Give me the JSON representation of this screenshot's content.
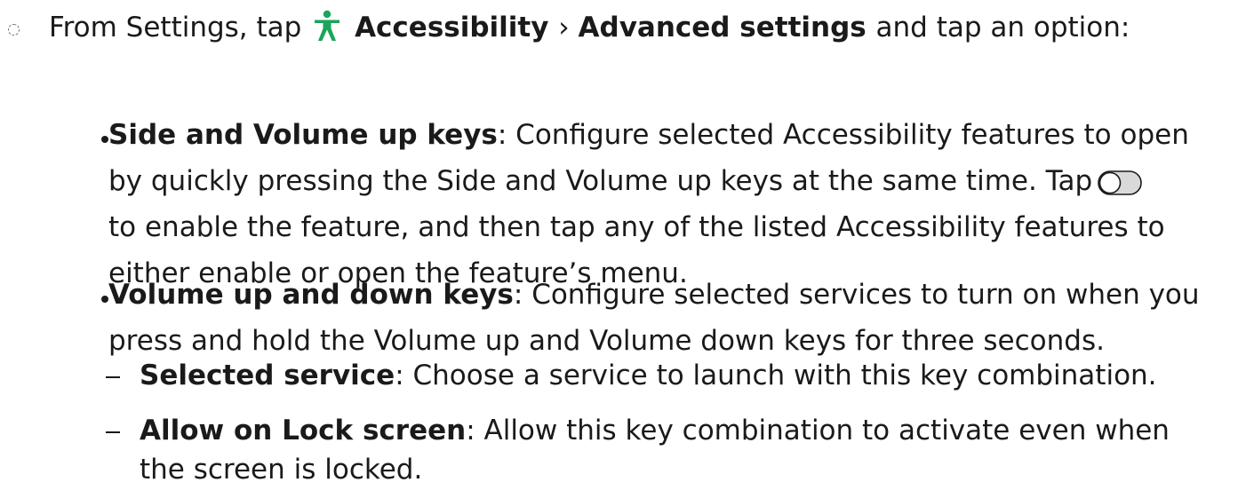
{
  "step": {
    "prefix": "From Settings, tap",
    "accessibility_label": "Accessibility",
    "separator": "›",
    "advanced_label": "Advanced settings",
    "suffix": "and tap an option:"
  },
  "bullets": [
    {
      "term": "Side and Volume up keys",
      "lines": [
        ": Configure selected Accessibility features to open",
        "by quickly pressing the Side and Volume up keys at the same time. Tap",
        "to enable the feature, and then tap any of the listed Accessibility features to",
        "either enable or open the feature’s menu."
      ]
    },
    {
      "term": "Volume up and down keys",
      "lines": [
        ": Configure selected services to turn on when you",
        "press and hold the Volume up and Volume down keys for three seconds."
      ]
    }
  ],
  "subitems": [
    {
      "term": "Selected service",
      "lines": [
        ": Choose a service to launch with this key combination."
      ]
    },
    {
      "term": "Allow on Lock screen",
      "lines": [
        ": Allow this key combination to activate even when",
        "the screen is locked."
      ]
    }
  ],
  "icons": {
    "step_marker": "dotted-circle-icon",
    "accessibility": "accessibility-person-icon",
    "toggle": "toggle-switch-off-icon"
  },
  "colors": {
    "accessibility_icon": "#1aa55a",
    "text": "#1a1a1a",
    "toggle_track": "#d9d9d9",
    "toggle_knob": "#ffffff"
  }
}
